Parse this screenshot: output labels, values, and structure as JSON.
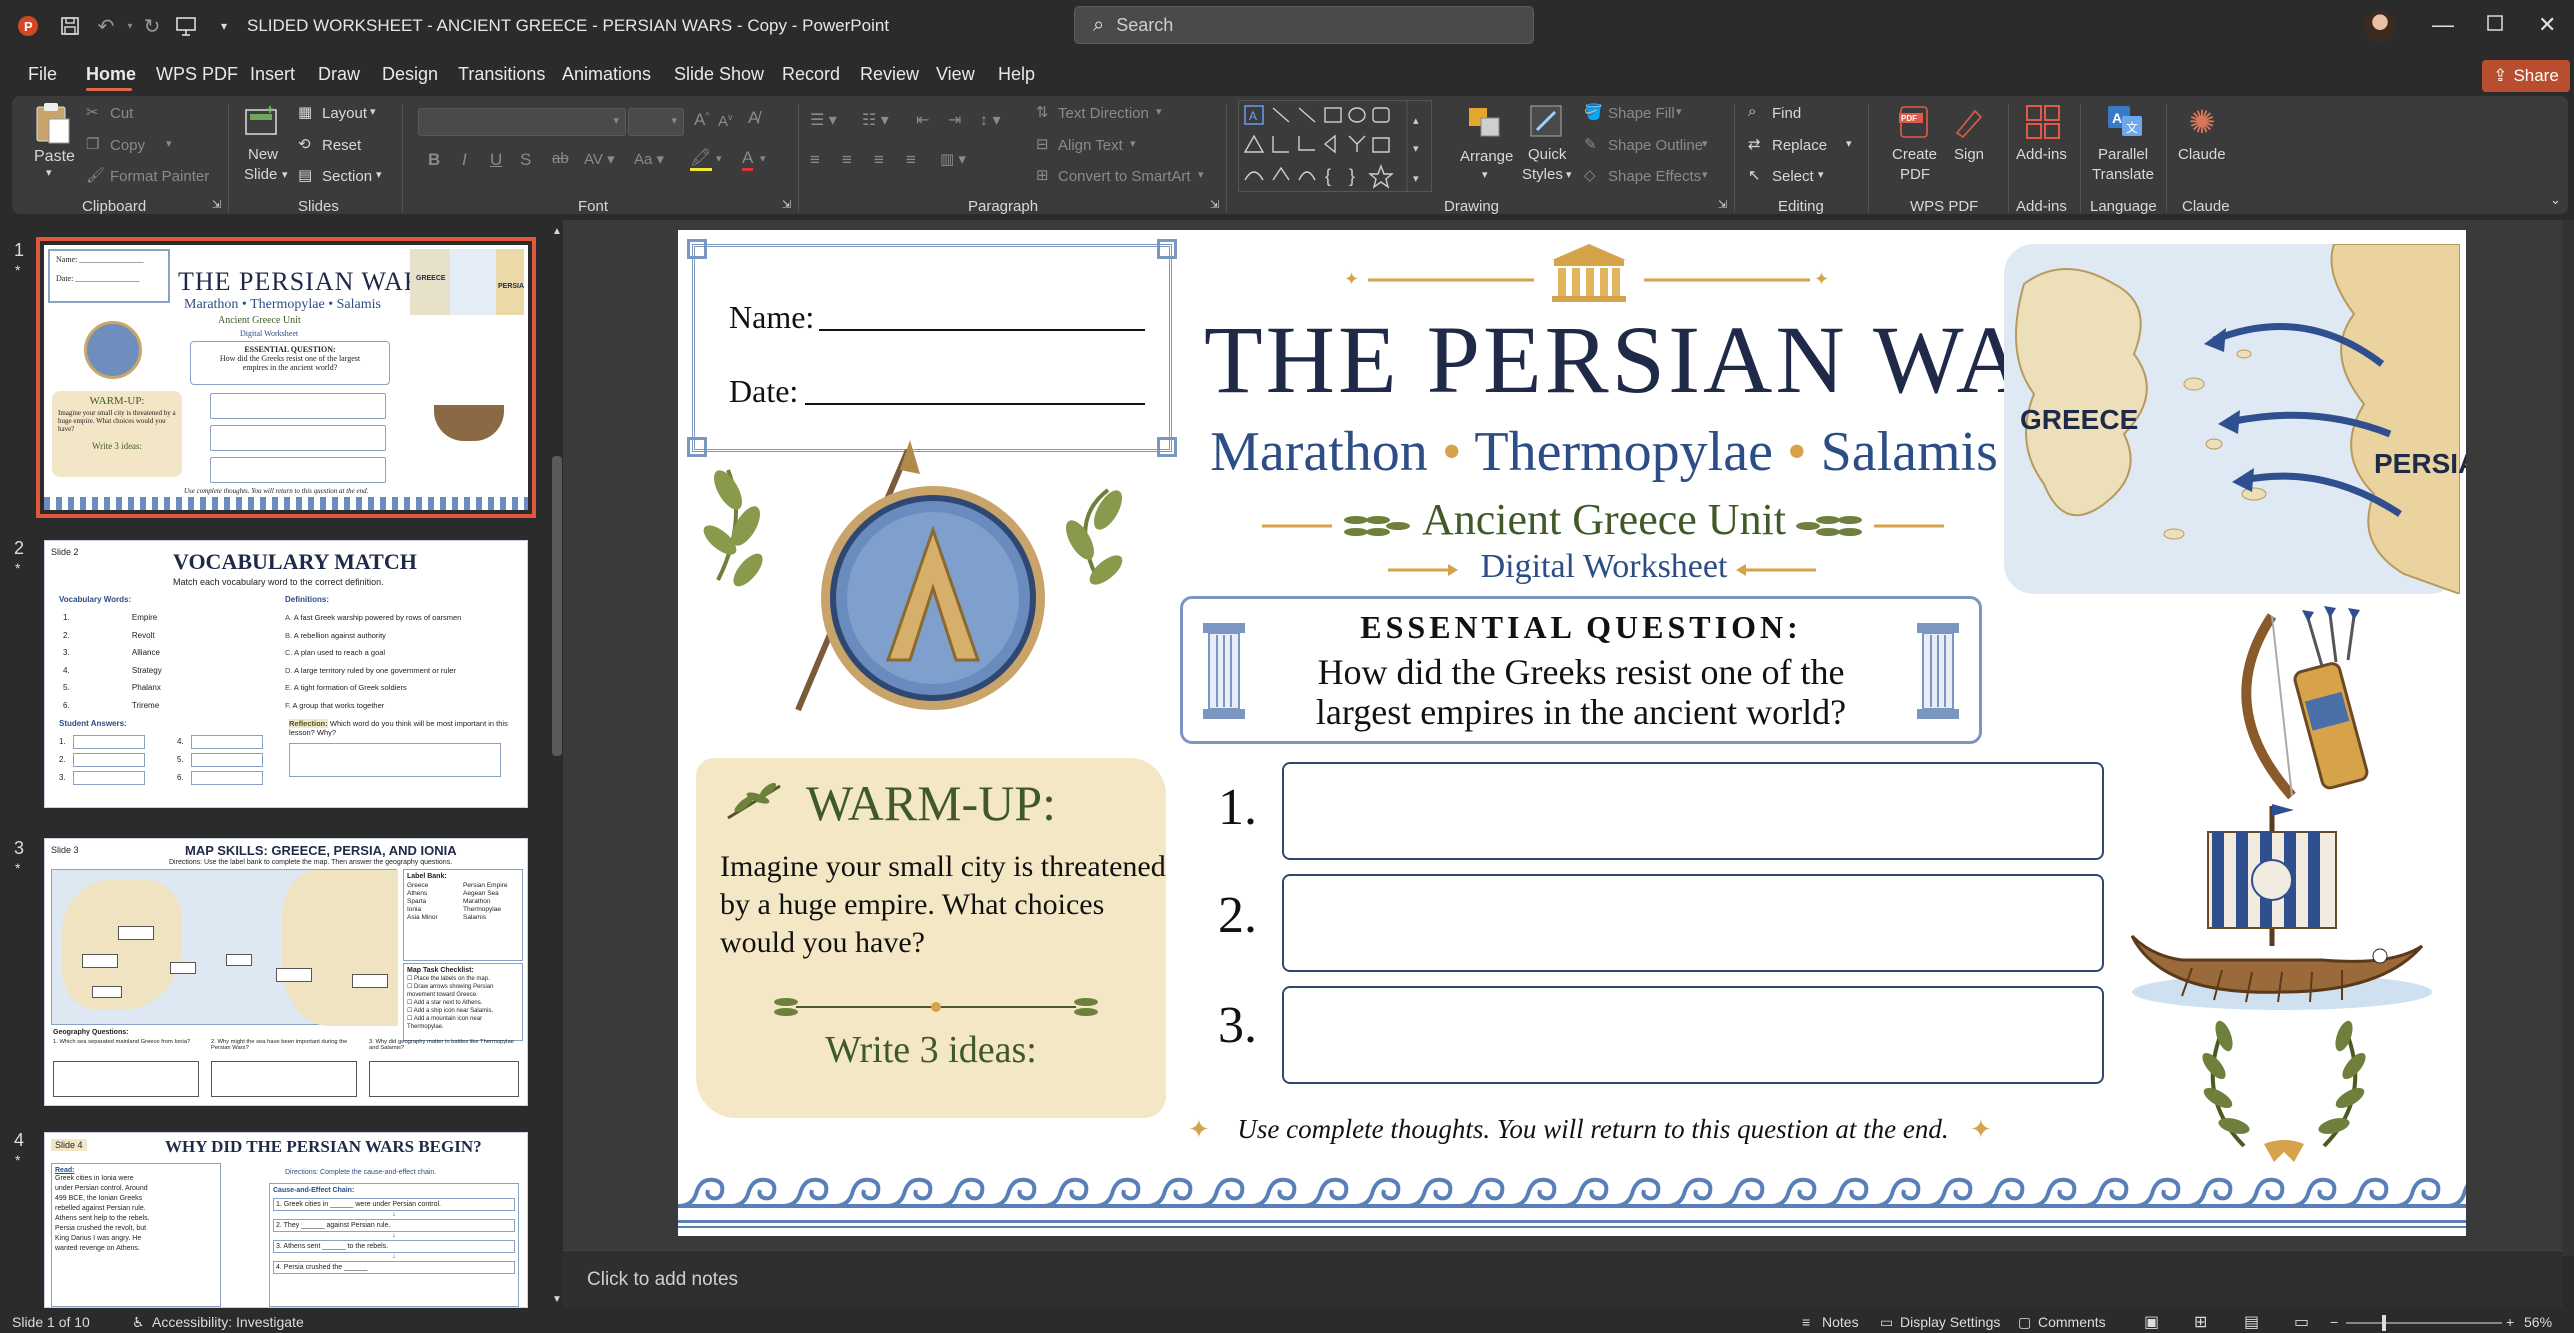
{
  "window": {
    "title": "SLIDED WORKSHEET - ANCIENT GREECE - PERSIAN WARS - Copy  -  PowerPoint",
    "search_placeholder": "Search"
  },
  "menu": {
    "items": [
      "File",
      "Home",
      "WPS PDF",
      "Insert",
      "Draw",
      "Design",
      "Transitions",
      "Animations",
      "Slide Show",
      "Record",
      "Review",
      "View",
      "Help"
    ],
    "share": "Share"
  },
  "ribbon": {
    "clipboard": {
      "paste": "Paste",
      "cut": "Cut",
      "copy": "Copy",
      "format_painter": "Format Painter",
      "group": "Clipboard"
    },
    "slides": {
      "new_slide_1": "New",
      "new_slide_2": "Slide",
      "layout": "Layout",
      "reset": "Reset",
      "section": "Section",
      "group": "Slides"
    },
    "font": {
      "group": "Font"
    },
    "paragraph": {
      "text_direction": "Text Direction",
      "align_text": "Align Text",
      "convert_smartart": "Convert to SmartArt",
      "group": "Paragraph"
    },
    "drawing": {
      "arrange": "Arrange",
      "quick_styles_1": "Quick",
      "quick_styles_2": "Styles",
      "shape_fill": "Shape Fill",
      "shape_outline": "Shape Outline",
      "shape_effects": "Shape Effects",
      "group": "Drawing"
    },
    "editing": {
      "find": "Find",
      "replace": "Replace",
      "select": "Select",
      "group": "Editing"
    },
    "wps_pdf": {
      "create_pdf_1": "Create",
      "create_pdf_2": "PDF",
      "sign": "Sign",
      "group": "WPS PDF"
    },
    "addins": {
      "addins": "Add-ins",
      "group": "Add-ins"
    },
    "language": {
      "parallel_1": "Parallel",
      "parallel_2": "Translate",
      "group": "Language"
    },
    "claude": {
      "claude": "Claude",
      "group": "Claude"
    }
  },
  "thumbnails": [
    {
      "num": "1",
      "star": "*",
      "title": "THE PERSIAN WARS",
      "sub": "Marathon • Thermopylae • Salamis",
      "unit": "Ancient Greece Unit",
      "ws": "Digital Worksheet",
      "eq": "ESSENTIAL QUESTION:",
      "q": "How did the Greeks resist one of the largest empires in the ancient world?",
      "name": "Name:",
      "date": "Date:",
      "warm": "WARM-UP:",
      "warm_text": "Imagine your small city is threatened by a huge empire. What choices would you have?",
      "write": "Write 3 ideas:",
      "greece": "GREECE",
      "persia": "PERSIA",
      "footer": "Use complete thoughts. You will return to this question at the end."
    },
    {
      "num": "2",
      "star": "*",
      "label": "Slide 2",
      "title": "VOCABULARY MATCH",
      "sub": "Match each vocabulary word to the correct definition.",
      "words_h": "Vocabulary Words:",
      "defs_h": "Definitions:",
      "words": [
        "Empire",
        "Revolt",
        "Alliance",
        "Strategy",
        "Phalanx",
        "Trireme"
      ],
      "defs": [
        "A fast Greek warship powered by rows of oarsmen",
        "A rebellion against authority",
        "A plan used to reach a goal",
        "A large territory ruled by one government or ruler",
        "A tight formation of Greek soldiers",
        "A group that works together"
      ],
      "letters": [
        "A.",
        "B.",
        "C.",
        "D.",
        "E.",
        "F."
      ],
      "answers_h": "Student Answers:",
      "reflection": "Reflection:",
      "reflection_q": "Which word do you think will be most important in this lesson? Why?"
    },
    {
      "num": "3",
      "star": "*",
      "label": "Slide 3",
      "title": "MAP SKILLS: GREECE, PERSIA, AND IONIA",
      "sub": "Directions: Use the label bank to complete the map. Then answer the geography questions.",
      "bank_h": "Label Bank:",
      "bank": [
        "Greece",
        "Persian Empire",
        "Athens",
        "Aegean Sea",
        "Sparta",
        "Marathon",
        "Ionia",
        "Thermopylae",
        "Asia Minor",
        "Salamis"
      ],
      "tasks_h": "Map Task Checklist:",
      "tasks": [
        "Place the labels on the map.",
        "Draw arrows showing Persian movement toward Greece.",
        "Add a star next to Athens.",
        "Add a ship icon near Salamis.",
        "Add a mountain icon near Thermopylae."
      ],
      "geo_h": "Geography Questions:",
      "geo_q": [
        "1. Which sea separated mainland Greece from Ionia?",
        "2. Why might the sea have been important during the Persian Wars?",
        "3. Why did geography matter in battles like Thermopylae and Salamis?"
      ]
    },
    {
      "num": "4",
      "star": "*",
      "label": "Slide 4",
      "title": "WHY DID THE PERSIAN WARS BEGIN?",
      "read_h": "Read:",
      "read": "Greek cities in Ionia were under Persian control. Around 499 BCE, the Ionian Greeks rebelled against Persian rule. Athens sent help to the rebels. Persia crushed the revolt, but King Darius I was angry. He wanted revenge on Athens.",
      "dir": "Directions: Complete the cause-and-effect chain.",
      "chain_h": "Cause-and-Effect Chain:",
      "chain": [
        "1. Greek cities in ______ were under Persian control.",
        "2. They ______ against Persian rule.",
        "3. Athens sent ______ to the rebels.",
        "4. Persia crushed the ______"
      ]
    }
  ],
  "slide": {
    "name_label": "Name:",
    "date_label": "Date:",
    "title": "THE PERSIAN WARS",
    "subtitle_parts": [
      "Marathon",
      "Thermopylae",
      "Salamis"
    ],
    "unit": "Ancient Greece Unit",
    "worksheet": "Digital Worksheet",
    "eq_label": "ESSENTIAL QUESTION:",
    "eq_line1": "How did the Greeks resist one of the",
    "eq_line2": "largest empires in the ancient world?",
    "map_greece": "GREECE",
    "map_persia": "PERSIA",
    "warmup_title": "WARM-UP:",
    "warmup_lines": [
      "Imagine your small city is threatened",
      "by a huge empire. What choices",
      "would you have?"
    ],
    "write_ideas": "Write 3 ideas:",
    "answer_nums": [
      "1.",
      "2.",
      "3."
    ],
    "footer": "Use complete thoughts. You will return to this question at the end."
  },
  "notes_placeholder": "Click to add notes",
  "status": {
    "slide_count": "Slide 1 of 10",
    "accessibility": "Accessibility: Investigate",
    "notes": "Notes",
    "display": "Display Settings",
    "comments": "Comments",
    "zoom": "56%"
  }
}
